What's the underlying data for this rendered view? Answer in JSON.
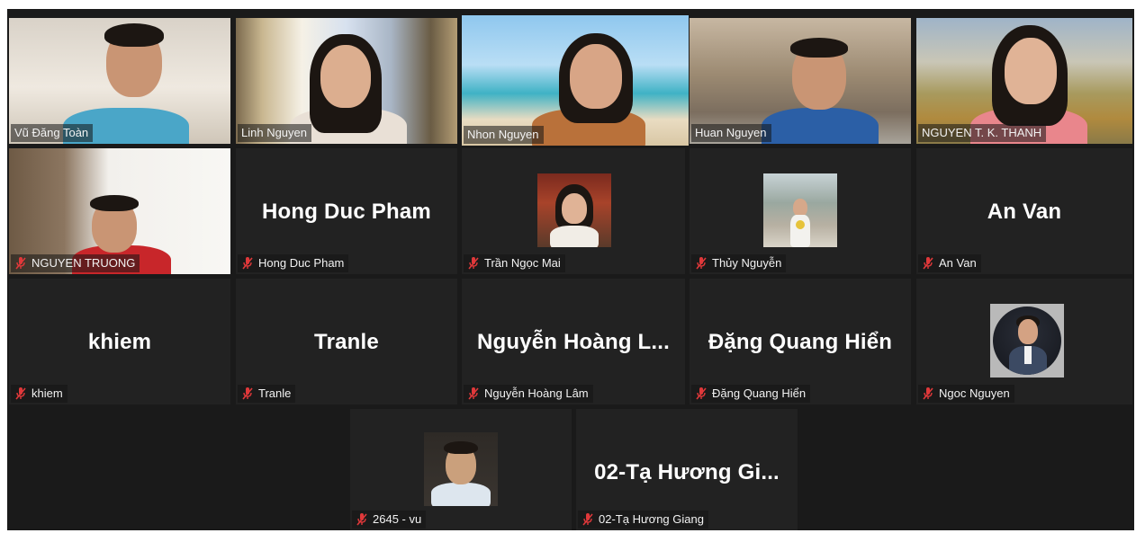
{
  "meeting": {
    "participants": [
      {
        "id": "p1",
        "name": "Vũ Đăng Toàn",
        "video": true,
        "muted": false,
        "active": false
      },
      {
        "id": "p2",
        "name": "Linh Nguyen",
        "video": true,
        "muted": false,
        "active": false
      },
      {
        "id": "p3",
        "name": "Nhon Nguyen",
        "video": true,
        "muted": false,
        "active": true
      },
      {
        "id": "p4",
        "name": "Huan Nguyen",
        "video": true,
        "muted": false,
        "active": false
      },
      {
        "id": "p5",
        "name": "NGUYEN T. K. THANH",
        "video": true,
        "muted": false,
        "active": false
      },
      {
        "id": "p6",
        "name": "NGUYEN TRUONG",
        "video": true,
        "muted": true,
        "active": false
      },
      {
        "id": "p7",
        "name": "Hong Duc Pham",
        "display_name": "Hong Duc Pham",
        "video": false,
        "muted": true
      },
      {
        "id": "p8",
        "name": "Trần Ngọc Mai",
        "video": false,
        "muted": true,
        "avatar": "photo"
      },
      {
        "id": "p9",
        "name": "Thủy Nguyễn",
        "video": false,
        "muted": true,
        "avatar": "photo"
      },
      {
        "id": "p10",
        "name": "An Van",
        "display_name": "An Van",
        "video": false,
        "muted": true
      },
      {
        "id": "p11",
        "name": "khiem",
        "display_name": "khiem",
        "video": false,
        "muted": true
      },
      {
        "id": "p12",
        "name": "Tranle",
        "display_name": "Tranle",
        "video": false,
        "muted": true
      },
      {
        "id": "p13",
        "name": "Nguyễn Hoàng Lâm",
        "display_name": "Nguyễn Hoàng L...",
        "video": false,
        "muted": true
      },
      {
        "id": "p14",
        "name": "Đặng Quang Hiển",
        "display_name": "Đặng Quang Hiển",
        "video": false,
        "muted": true
      },
      {
        "id": "p15",
        "name": "Ngoc Nguyen",
        "video": false,
        "muted": true,
        "avatar": "photo-round"
      },
      {
        "id": "p16",
        "name": "2645 - vu",
        "video": false,
        "muted": true,
        "avatar": "photo"
      },
      {
        "id": "p17",
        "name": "02-Tạ Hương Giang",
        "display_name": "02-Tạ Hương Gi...",
        "video": false,
        "muted": true
      }
    ]
  },
  "colors": {
    "active_speaker_border": "#dbe870",
    "muted_icon": "#e0383a",
    "tile_background": "#222222",
    "gallery_background": "#1a1a1a"
  },
  "icons": {
    "muted": "microphone-muted-icon"
  }
}
